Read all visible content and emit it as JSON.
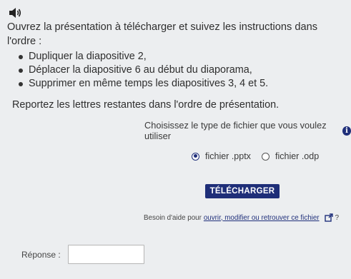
{
  "instructions": {
    "text": "Ouvrez la présentation à télécharger et suivez les instructions dans l'ordre :",
    "bullets": [
      "Dupliquer la diapositive 2,",
      "Déplacer la diapositive 6 au début du diaporama,",
      "Supprimer en même temps les diapositives 3, 4 et 5."
    ],
    "report": "Reportez les lettres restantes dans l'ordre de présentation."
  },
  "file_type": {
    "prompt": "Choisissez le type de fichier que vous voulez utiliser",
    "options": [
      "fichier .pptx",
      "fichier .odp"
    ],
    "selected": "fichier .pptx"
  },
  "download": {
    "label": "TÉLÉCHARGER"
  },
  "help": {
    "prefix": "Besoin d'aide pour",
    "link": "ouvrir, modifier ou retrouver ce fichier",
    "suffix": "?"
  },
  "answer": {
    "label": "Réponse :",
    "value": ""
  },
  "icons": {
    "audio": "speaker-icon",
    "info": "info-icon",
    "external": "external-link-icon"
  },
  "colors": {
    "accent": "#1e2e78",
    "background": "#eceef0"
  }
}
